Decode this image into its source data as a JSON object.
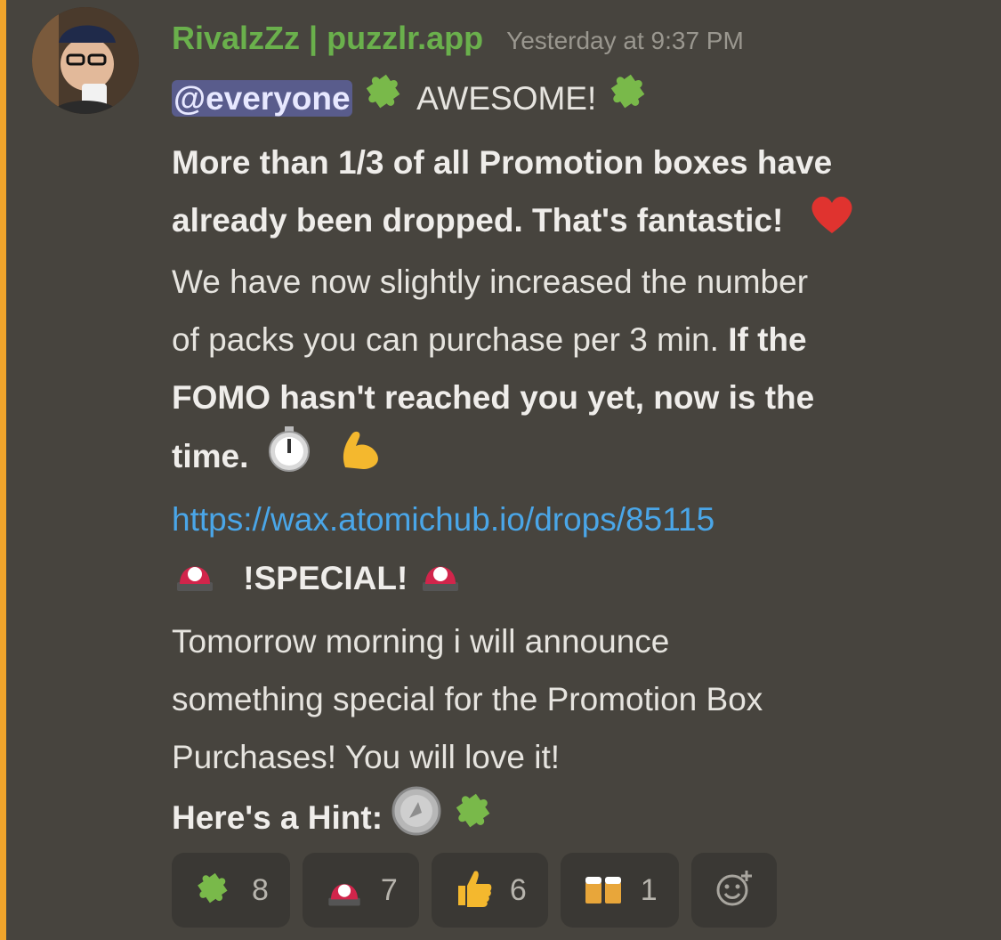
{
  "message": {
    "author": "RivalzZz | puzzlr.app",
    "timestamp": "Yesterday at 9:37 PM",
    "mention": "@everyone",
    "l1_text": "AWESOME!",
    "l2_bold": "More than 1/3 of all Promotion boxes have",
    "l3_bold": "already been dropped. That's fantastic!",
    "l4_text": "We have now slightly increased the number",
    "l5_text": "of packs you can purchase per 3 min. ",
    "l5_bold": "If the",
    "l6_bold": "FOMO hasn't reached you yet, now is the",
    "l7_bold": "time.",
    "link": "https://wax.atomichub.io/drops/85115",
    "special": "!SPECIAL!",
    "l10_text": "Tomorrow morning i will announce",
    "l11_text": "something special for the Promotion Box",
    "l12_text": "Purchases! You will love it!",
    "hint": "Here's a Hint:"
  },
  "reactions": [
    {
      "icon": "puzzle-piece-icon",
      "count": "8"
    },
    {
      "icon": "rotating-light-icon",
      "count": "7"
    },
    {
      "icon": "thumbs-up-icon",
      "count": "6"
    },
    {
      "icon": "beers-icon",
      "count": "1"
    }
  ],
  "colors": {
    "username": "#6ab04c",
    "link": "#4aa6e8",
    "mention_bg": "#595c8c",
    "accent": "#f0a42b"
  }
}
